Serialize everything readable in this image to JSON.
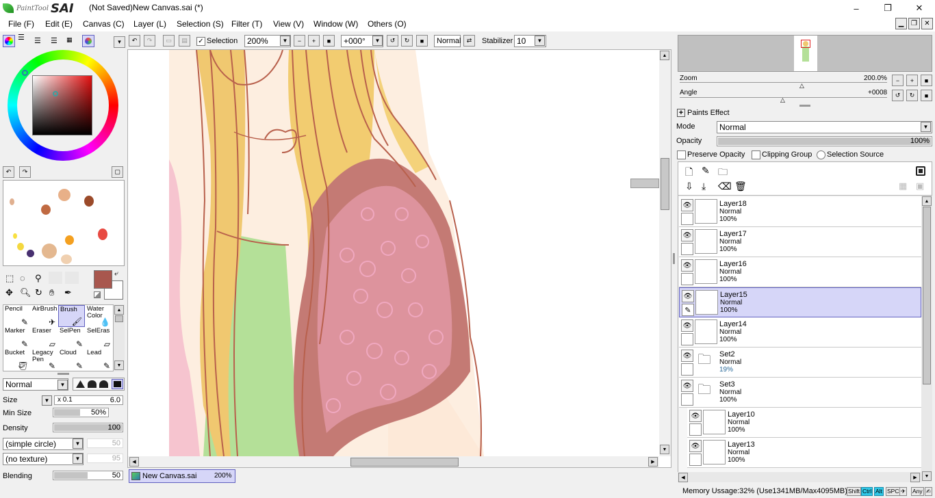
{
  "window": {
    "app_name_small": "PaintTool",
    "app_name_big": "SAI",
    "title": "(Not Saved)New Canvas.sai (*)",
    "minimize": "–",
    "maximize": "❐",
    "close": "✕"
  },
  "menu": [
    "File (F)",
    "Edit (E)",
    "Canvas (C)",
    "Layer (L)",
    "Selection (S)",
    "Filter (T)",
    "View (V)",
    "Window (W)",
    "Others (O)"
  ],
  "toolbar": {
    "selection_label": "Selection",
    "zoom": "200%",
    "angle": "+000°",
    "blend": "Normal",
    "stabilizer_label": "Stabilizer",
    "stabilizer_value": "10"
  },
  "navigator": {
    "zoom_label": "Zoom",
    "zoom_value": "200.0%",
    "angle_label": "Angle",
    "angle_value": "+0008"
  },
  "layer_props": {
    "paints_effect": "Paints Effect",
    "mode_label": "Mode",
    "mode_value": "Normal",
    "opacity_label": "Opacity",
    "opacity_value": "100%",
    "opacity_fraction": 1.0,
    "preserve_opacity": "Preserve Opacity",
    "clipping_group": "Clipping Group",
    "selection_source": "Selection Source"
  },
  "layers": [
    {
      "name": "Layer18",
      "mode": "Normal",
      "opacity": "100%",
      "selected": false,
      "folder": false,
      "indent": false
    },
    {
      "name": "Layer17",
      "mode": "Normal",
      "opacity": "100%",
      "selected": false,
      "folder": false,
      "indent": false
    },
    {
      "name": "Layer16",
      "mode": "Normal",
      "opacity": "100%",
      "selected": false,
      "folder": false,
      "indent": false
    },
    {
      "name": "Layer15",
      "mode": "Normal",
      "opacity": "100%",
      "selected": true,
      "folder": false,
      "indent": false
    },
    {
      "name": "Layer14",
      "mode": "Normal",
      "opacity": "100%",
      "selected": false,
      "folder": false,
      "indent": false
    },
    {
      "name": "Set2",
      "mode": "Normal",
      "opacity": "19%",
      "selected": false,
      "folder": true,
      "indent": false
    },
    {
      "name": "Set3",
      "mode": "Normal",
      "opacity": "100%",
      "selected": false,
      "folder": true,
      "indent": false
    },
    {
      "name": "Layer10",
      "mode": "Normal",
      "opacity": "100%",
      "selected": false,
      "folder": false,
      "indent": true
    },
    {
      "name": "Layer13",
      "mode": "Normal",
      "opacity": "100%",
      "selected": false,
      "folder": false,
      "indent": true
    }
  ],
  "tools": [
    {
      "label": "Pencil",
      "selected": false
    },
    {
      "label": "AirBrush",
      "selected": false
    },
    {
      "label": "Brush",
      "selected": true
    },
    {
      "label": "Water Color",
      "selected": false
    },
    {
      "label": "Marker",
      "selected": false
    },
    {
      "label": "Eraser",
      "selected": false
    },
    {
      "label": "SelPen",
      "selected": false
    },
    {
      "label": "SelEras",
      "selected": false
    },
    {
      "label": "Bucket",
      "selected": false
    },
    {
      "label": "Legacy Pen",
      "selected": false
    },
    {
      "label": "Cloud",
      "selected": false
    },
    {
      "label": "Lead",
      "selected": false
    }
  ],
  "brush": {
    "blend_mode": "Normal",
    "size_label": "Size",
    "size_mult": "x 0.1",
    "size_value": "6.0",
    "min_size_label": "Min Size",
    "min_size_value": "50%",
    "min_size_fraction": 0.5,
    "density_label": "Density",
    "density_value": "100",
    "density_fraction": 1.0,
    "shape": "(simple circle)",
    "shape_value": "50",
    "texture": "(no texture)",
    "texture_value": "95",
    "blending_label": "Blending",
    "blending_value": "50",
    "blending_fraction": 0.5
  },
  "colors": {
    "primary": "#a8574e",
    "secondary": "#ffffff",
    "accent_selected": "#d6d6f8",
    "statusbar_key_on": "#2ec8e8"
  },
  "doc_tab": {
    "name": "New Canvas.sai",
    "zoom": "200%"
  },
  "status": {
    "memory": "Memory Ussage:32% (Use1341MB/Max4095MB)",
    "keys": [
      {
        "label": "Shift",
        "on": false
      },
      {
        "label": "Ctrl",
        "on": true
      },
      {
        "label": "Alt",
        "on": true
      },
      {
        "label": "SPC",
        "on": false
      },
      {
        "label": "✈",
        "on": false
      },
      {
        "label": "Any",
        "on": false
      },
      {
        "label": "✍",
        "on": false
      }
    ]
  }
}
